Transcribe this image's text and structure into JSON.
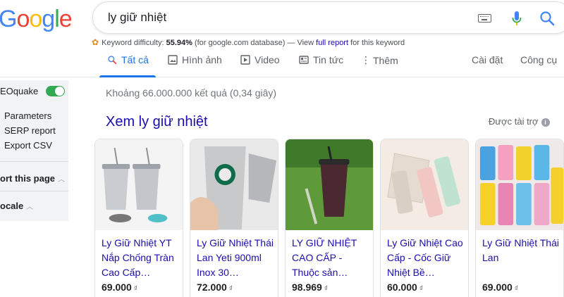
{
  "logo": {
    "letters": [
      "G",
      "o",
      "o",
      "g",
      "l",
      "e"
    ],
    "colors": [
      "#4285f4",
      "#ea4335",
      "#fbbc05",
      "#4285f4",
      "#34a853",
      "#ea4335"
    ]
  },
  "search": {
    "query": "ly giữ nhiệt"
  },
  "keyword_line": {
    "prefix": "Keyword difficulty: ",
    "value": "55.94%",
    "middle": " (for google.com database) — View ",
    "link": "full report",
    "suffix": " for this keyword"
  },
  "tabs": [
    {
      "label": "Tất cả",
      "icon": "search-icon"
    },
    {
      "label": "Hình ảnh",
      "icon": "image-icon"
    },
    {
      "label": "Video",
      "icon": "video-icon"
    },
    {
      "label": "Tin tức",
      "icon": "news-icon"
    },
    {
      "label": "Thêm",
      "icon": "more-vert-icon"
    },
    {
      "label": "Cài đặt"
    },
    {
      "label": "Công cụ"
    }
  ],
  "sidepanel": {
    "title": "EOquake",
    "links": [
      "Parameters",
      "SERP report",
      "Export CSV"
    ],
    "sections": [
      "ort this page",
      "ocale"
    ]
  },
  "result_stats": "Khoảng 66.000.000 kết quả (0,34 giây)",
  "shopping": {
    "title": "Xem ly giữ nhiệt",
    "sponsored": "Được tài trợ",
    "products": [
      {
        "title": "Ly Giữ Nhiệt YT Nắp Chống Tràn Cao Cấp…",
        "price": "69.000",
        "currency": "₫"
      },
      {
        "title": "Ly Giữ Nhiệt Thái Lan Yeti 900ml Inox 30…",
        "price": "72.000",
        "currency": "₫"
      },
      {
        "title": "LY GIỮ NHIỆT CAO CẤP - Thuộc sản…",
        "price": "98.969",
        "currency": "₫"
      },
      {
        "title": "Ly Giữ Nhiệt Cao Cấp - Cốc Giữ Nhiệt Bề…",
        "price": "60.000",
        "currency": "₫"
      },
      {
        "title": "Ly Giữ Nhiệt Thái Lan",
        "price": "69.000",
        "currency": "₫"
      }
    ]
  },
  "colors": {
    "link": "#1a0dab",
    "accent": "#1a73e8",
    "toggle": "#34a853"
  }
}
